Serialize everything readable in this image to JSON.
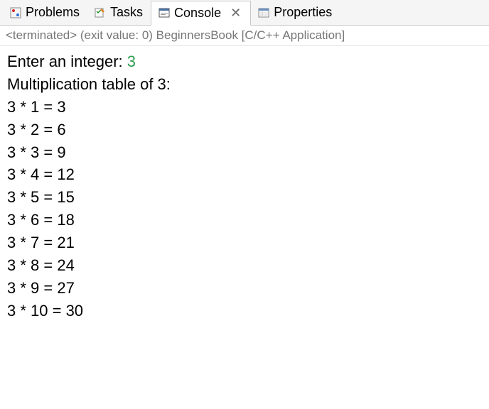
{
  "tabs": {
    "problems": "Problems",
    "tasks": "Tasks",
    "console": "Console",
    "properties": "Properties"
  },
  "status": "<terminated> (exit value: 0) BeginnersBook [C/C++ Application]",
  "console_output": {
    "prompt": "Enter an integer: ",
    "input_value": "3",
    "heading": "Multiplication table of 3:",
    "lines": {
      "l0": "3 * 1 = 3",
      "l1": "3 * 2 = 6",
      "l2": "3 * 3 = 9",
      "l3": "3 * 4 = 12",
      "l4": "3 * 5 = 15",
      "l5": "3 * 6 = 18",
      "l6": "3 * 7 = 21",
      "l7": "3 * 8 = 24",
      "l8": "3 * 9 = 27",
      "l9": "3 * 10 = 30"
    }
  }
}
